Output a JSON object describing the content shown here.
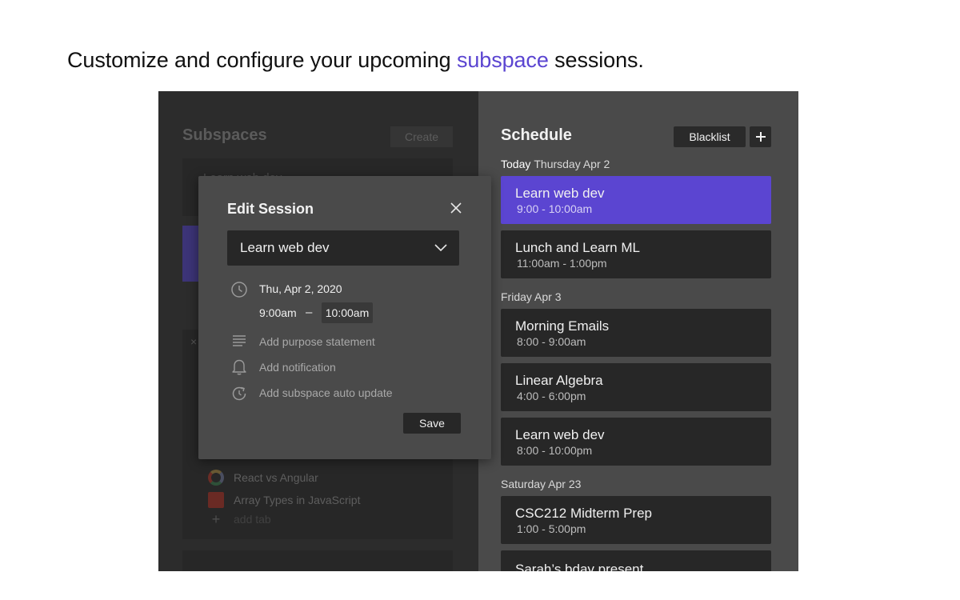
{
  "headline": {
    "before": "Customize and configure your upcoming ",
    "accent": "subspace",
    "after": " sessions.",
    "accent_color": "#5b45d1"
  },
  "subspaces_panel": {
    "title": "Subspaces",
    "create_label": "Create",
    "card_label": "Learn web dev",
    "close_mark": "×",
    "tabs": [
      {
        "icon": "google-icon",
        "label": "React vs Angular"
      },
      {
        "icon": "article-icon",
        "label": "Array Types in JavaScript"
      }
    ],
    "add_tab_icon": "+",
    "add_tab_label": "add tab"
  },
  "schedule": {
    "title": "Schedule",
    "blacklist_label": "Blacklist",
    "add_icon": "plus-icon",
    "days": [
      {
        "prefix": "Today",
        "label": "Thursday Apr 2"
      },
      {
        "prefix": "",
        "label": "Friday Apr 3"
      },
      {
        "prefix": "",
        "label": "Saturday Apr 23"
      }
    ],
    "events": [
      {
        "title": "Learn web dev",
        "time": "9:00 - 10:00am",
        "active": true
      },
      {
        "title": "Lunch and Learn ML",
        "time": "11:00am - 1:00pm"
      },
      {
        "title": "Morning Emails",
        "time": "8:00 - 9:00am"
      },
      {
        "title": "Linear Algebra",
        "time": "4:00 - 6:00pm"
      },
      {
        "title": "Learn web dev",
        "time": "8:00 - 10:00pm"
      },
      {
        "title": "CSC212 Midterm Prep",
        "time": "1:00 - 5:00pm"
      },
      {
        "title": "Sarah’s bday present",
        "time": ""
      }
    ],
    "accent_color": "#5b45d1"
  },
  "modal": {
    "title": "Edit Session",
    "close_icon": "close-icon",
    "subspace_value": "Learn web dev",
    "date": "Thu, Apr 2, 2020",
    "start_time": "9:00am",
    "separator": "–",
    "end_time": "10:00am",
    "purpose_placeholder": "Add purpose statement",
    "notification_placeholder": "Add notification",
    "auto_update_placeholder": "Add subspace auto update",
    "save_label": "Save"
  }
}
